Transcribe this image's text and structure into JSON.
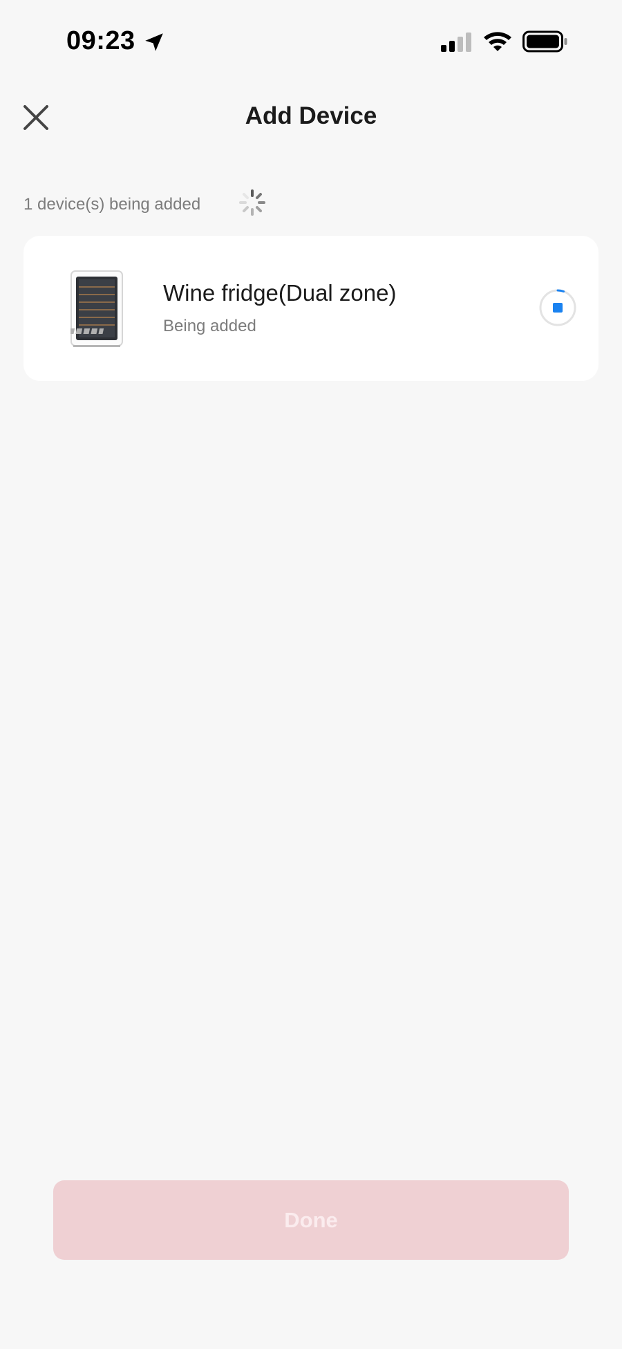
{
  "status_bar": {
    "time": "09:23",
    "icons": [
      "location-arrow-icon",
      "cellular-signal-icon",
      "wifi-icon",
      "battery-icon"
    ]
  },
  "nav": {
    "title": "Add Device",
    "close_icon": "close-icon"
  },
  "progress": {
    "text": "1 device(s) being added",
    "spinner_icon": "loading-spinner-icon"
  },
  "devices": [
    {
      "name": "Wine fridge(Dual zone)",
      "status": "Being added",
      "image_icon": "wine-fridge-icon",
      "action_icon": "stop-progress-icon"
    }
  ],
  "footer": {
    "done_label": "Done"
  },
  "colors": {
    "background": "#f7f7f7",
    "card": "#ffffff",
    "accent_blue": "#1a82f0",
    "done_disabled_bg": "#efd0d3",
    "done_disabled_text": "#fbecee",
    "secondary_text": "#7c7c7c"
  }
}
